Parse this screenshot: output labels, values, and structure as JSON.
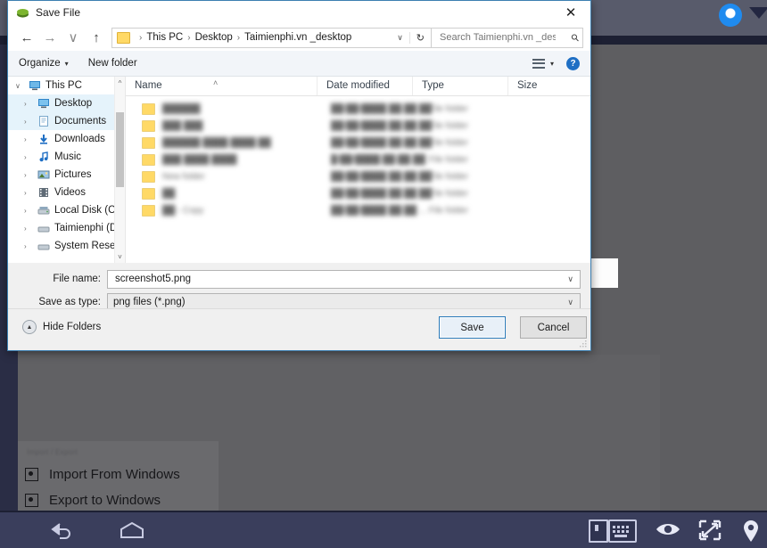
{
  "emulator": {
    "topbar": {
      "record_icon": "record-circle-icon",
      "triangle_icon": "triangle-down-icon"
    },
    "background_menu": {
      "section_title": "Import / Export",
      "items": [
        {
          "label": "Import From Windows",
          "icon": "import-icon"
        },
        {
          "label": "Export to Windows",
          "icon": "export-icon"
        }
      ]
    },
    "nav_bar": {
      "buttons": [
        {
          "name": "back-icon",
          "label": "Back"
        },
        {
          "name": "home-icon",
          "label": "Home"
        },
        {
          "name": "phone-icon",
          "label": "Phone"
        },
        {
          "name": "keyboard-icon",
          "label": "Keyboard"
        },
        {
          "name": "eye-icon",
          "label": "View"
        },
        {
          "name": "fullscreen-icon",
          "label": "Fullscreen"
        },
        {
          "name": "location-pin-icon",
          "label": "Location"
        }
      ]
    }
  },
  "dialog": {
    "title": "Save File",
    "close_label": "✕",
    "nav": {
      "back": "←",
      "forward": "→",
      "recent": "∨",
      "up": "↑"
    },
    "address": {
      "crumbs": [
        "This PC",
        "Desktop",
        "Taimienphi.vn _desktop"
      ],
      "separator": "›",
      "dropdown": "∨",
      "refresh": "↻"
    },
    "search": {
      "placeholder": "Search Taimienphi.vn _desktop",
      "value": "",
      "icon": "search-icon"
    },
    "command_bar": {
      "organize": "Organize",
      "organize_caret": "▾",
      "new_folder": "New folder",
      "view_caret": "▾",
      "help": "?"
    },
    "nav_pane": {
      "items": [
        {
          "label": "This PC",
          "icon": "computer-icon",
          "level": 0,
          "twisty": "∨",
          "selected": false
        },
        {
          "label": "Desktop",
          "icon": "desktop-icon",
          "level": 1,
          "twisty": "›",
          "selected": true
        },
        {
          "label": "Documents",
          "icon": "documents-icon",
          "level": 1,
          "twisty": "›",
          "selected": true
        },
        {
          "label": "Downloads",
          "icon": "downloads-icon",
          "level": 1,
          "twisty": "›",
          "selected": false
        },
        {
          "label": "Music",
          "icon": "music-icon",
          "level": 1,
          "twisty": "›",
          "selected": false
        },
        {
          "label": "Pictures",
          "icon": "pictures-icon",
          "level": 1,
          "twisty": "›",
          "selected": false
        },
        {
          "label": "Videos",
          "icon": "videos-icon",
          "level": 1,
          "twisty": "›",
          "selected": false
        },
        {
          "label": "Local Disk (C:)",
          "icon": "drive-icon",
          "level": 1,
          "twisty": "›",
          "selected": false
        },
        {
          "label": "Taimienphi (D:)",
          "icon": "drive-icon",
          "level": 1,
          "twisty": "›",
          "selected": false
        },
        {
          "label": "System Reserved",
          "icon": "drive-icon",
          "level": 1,
          "twisty": "›",
          "selected": false
        }
      ]
    },
    "file_list": {
      "columns": [
        "Name",
        "Date modified",
        "Type",
        "Size"
      ],
      "sort_indicator": "˄",
      "rows": [
        {
          "name": "██████",
          "date": "██/██/████ ██:██ ██",
          "type": "File folder",
          "size": ""
        },
        {
          "name": "███ ███",
          "date": "██/██/████ ██:██ ██",
          "type": "File folder",
          "size": ""
        },
        {
          "name": "██████ ████ ████ ██",
          "date": "██/██/████ ██:██ ██",
          "type": "File folder",
          "size": ""
        },
        {
          "name": "███ ████ ████",
          "date": "█/██/████ ██:██ ██",
          "type": "File folder",
          "size": ""
        },
        {
          "name": "New folder",
          "date": "██/██/████ ██:██ ██",
          "type": "File folder",
          "size": ""
        },
        {
          "name": "██",
          "date": "██/██/████ ██:██ ██",
          "type": "File folder",
          "size": ""
        },
        {
          "name": "██ - Copy",
          "date": "██/██/████ ██:██ ...",
          "type": "File folder",
          "size": ""
        }
      ]
    },
    "fields": {
      "file_name_label": "File name:",
      "file_name_value": "screenshot5.png",
      "save_as_type_label": "Save as type:",
      "save_as_type_value": "png files (*.png)",
      "dropdown_caret": "∨"
    },
    "footer": {
      "hide_folders": "Hide Folders",
      "hide_folders_caret": "▲",
      "save": "Save",
      "cancel": "Cancel"
    }
  },
  "colors": {
    "accent_blue": "#2a7ab9",
    "help_blue": "#1f6fc4",
    "selection": "#e5f3fb",
    "folder_yellow": "#ffd966",
    "overlay_gray": "#5e5e61",
    "navbar": "#3a3e5c"
  }
}
